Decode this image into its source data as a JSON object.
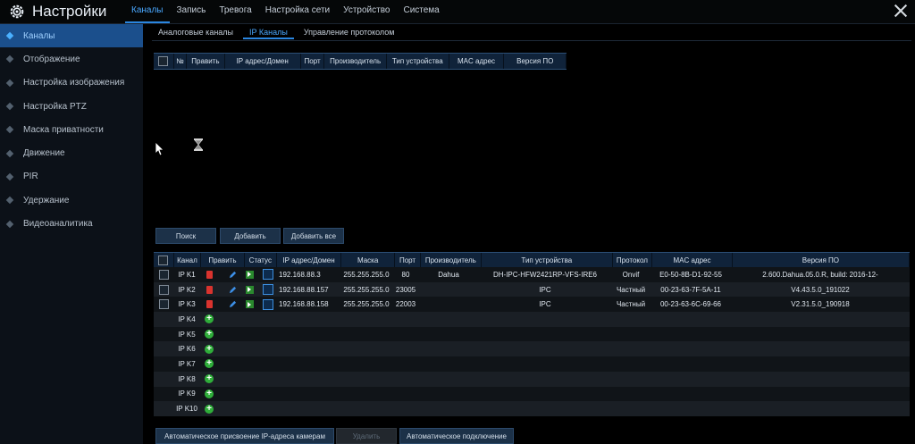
{
  "app": {
    "title": "Настройки"
  },
  "menu": [
    {
      "label": "Каналы",
      "active": true
    },
    {
      "label": "Запись"
    },
    {
      "label": "Тревога"
    },
    {
      "label": "Настройка сети"
    },
    {
      "label": "Устройство"
    },
    {
      "label": "Система"
    }
  ],
  "sidebar": [
    {
      "label": "Каналы",
      "active": true
    },
    {
      "label": "Отображение"
    },
    {
      "label": "Настройка изображения"
    },
    {
      "label": "Настройка PTZ"
    },
    {
      "label": "Маска приватности"
    },
    {
      "label": "Движение"
    },
    {
      "label": "PIR"
    },
    {
      "label": "Удержание"
    },
    {
      "label": "Видеоаналитика"
    }
  ],
  "subtabs": [
    {
      "label": "Аналоговые каналы"
    },
    {
      "label": "IP Каналы",
      "active": true
    },
    {
      "label": "Управление протоколом"
    }
  ],
  "search_table": {
    "headers": [
      "№",
      "Править",
      "IP адрес/Домен",
      "Порт",
      "Производитель",
      "Тип устройства",
      "MAC адрес",
      "Версия ПО"
    ]
  },
  "buttons": {
    "search": "Поиск",
    "add": "Добавить",
    "add_all": "Добавить все",
    "auto_assign": "Автоматическое присвоение IP-адреса камерам",
    "delete": "Удалить",
    "auto_connect": "Автоматическое подключение"
  },
  "channel_table": {
    "headers": [
      "Канал",
      "Править",
      "Статус",
      "IP адрес/Домен",
      "Маска",
      "Порт",
      "Производитель",
      "Тип устройства",
      "Протокол",
      "MAC адрес",
      "Версия ПО"
    ],
    "rows": [
      {
        "channel": "IP K1",
        "ip": "192.168.88.3",
        "mask": "255.255.255.0",
        "port": "80",
        "vendor": "Dahua",
        "type": "DH-IPC-HFW2421RP-VFS-IRE6",
        "protocol": "Onvif",
        "mac": "E0-50-8B-D1-92-55",
        "fw": "2.600.Dahua.05.0.R, build: 2016-12-"
      },
      {
        "channel": "IP K2",
        "ip": "192.168.88.157",
        "mask": "255.255.255.0",
        "port": "23005",
        "vendor": "",
        "type": "IPC",
        "protocol": "Частный",
        "mac": "00-23-63-7F-5A-11",
        "fw": "V4.43.5.0_191022"
      },
      {
        "channel": "IP K3",
        "ip": "192.168.88.158",
        "mask": "255.255.255.0",
        "port": "22003",
        "vendor": "",
        "type": "IPC",
        "protocol": "Частный",
        "mac": "00-23-63-6C-69-66",
        "fw": "V2.31.5.0_190918"
      }
    ],
    "empty_channels": [
      "IP K4",
      "IP K5",
      "IP K6",
      "IP K7",
      "IP K8",
      "IP K9",
      "IP K10"
    ]
  }
}
